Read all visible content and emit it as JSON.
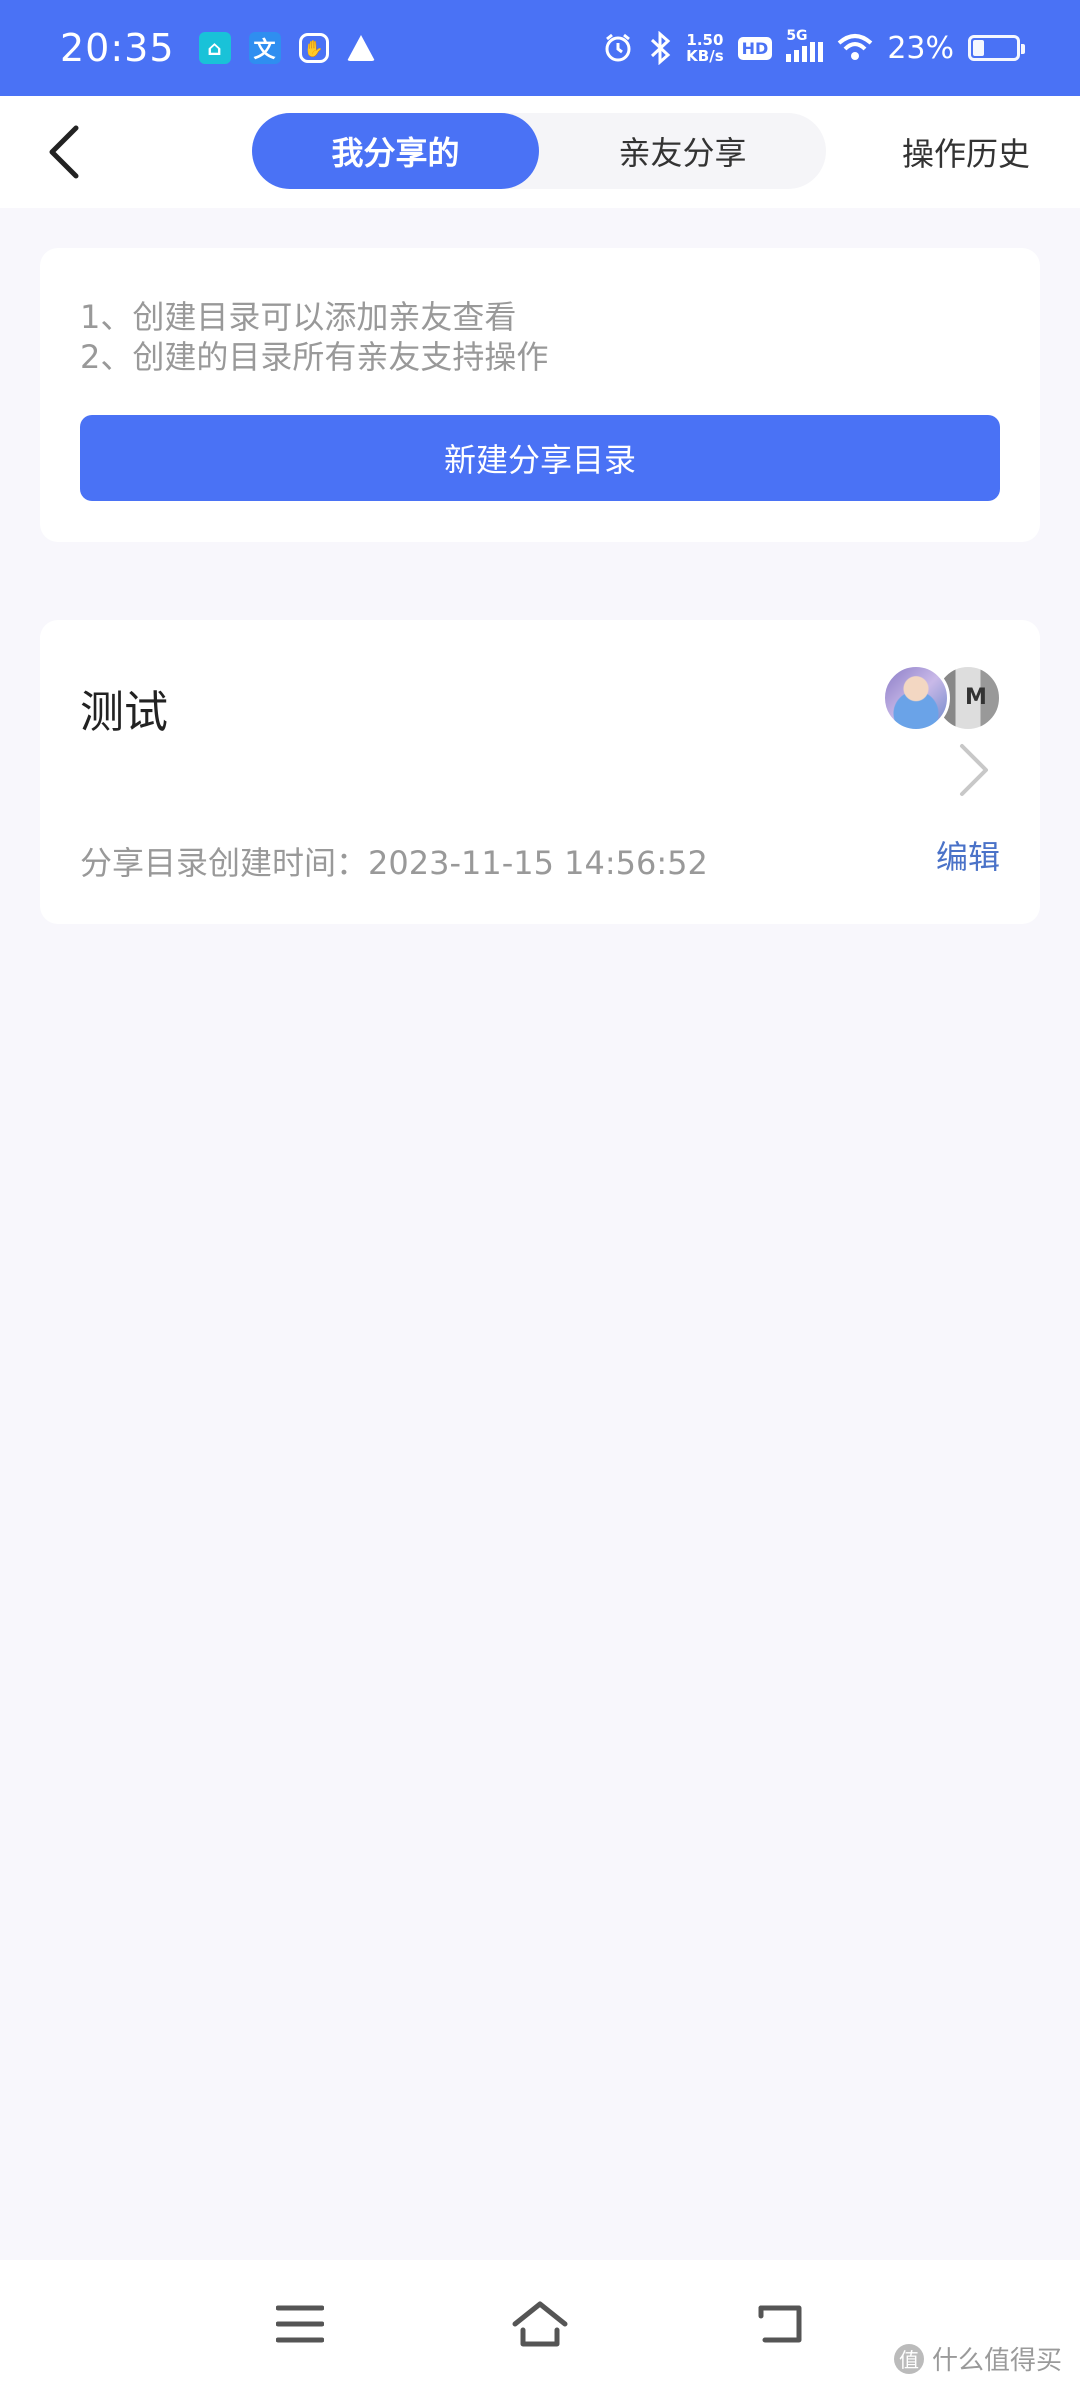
{
  "status_bar": {
    "time": "20:35",
    "speed_value": "1.50",
    "speed_unit": "KB/s",
    "hd": "HD",
    "network": "5G",
    "battery_percent": "23%",
    "battery_level": 0.23,
    "icons": [
      "home-app-icon",
      "translate-icon",
      "hand-icon",
      "warning-icon",
      "alarm-icon",
      "bluetooth-icon",
      "wifi-icon",
      "battery-icon"
    ]
  },
  "header": {
    "tabs": [
      {
        "label": "我分享的",
        "active": true
      },
      {
        "label": "亲友分享",
        "active": false
      }
    ],
    "history_label": "操作历史"
  },
  "info_card": {
    "line1": "1、创建目录可以添加亲友查看",
    "line2": "2、创建的目录所有亲友支持操作",
    "create_button": "新建分享目录"
  },
  "folders": [
    {
      "name": "测试",
      "created_label": "分享目录创建时间：2023-11-15 14:56:52",
      "edit_label": "编辑"
    }
  ],
  "watermark": {
    "logo": "值",
    "text": "什么值得买"
  },
  "colors": {
    "accent": "#4a72f5",
    "page_bg": "#f8f7fc",
    "muted_text": "#999999",
    "edit_link": "#4a72c8"
  }
}
